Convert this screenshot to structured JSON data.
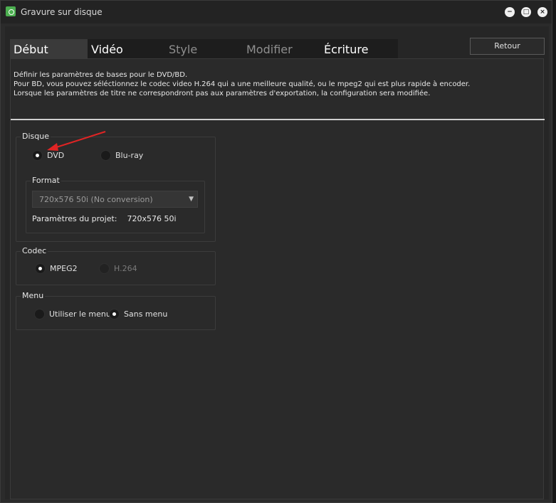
{
  "window": {
    "title": "Gravure sur disque"
  },
  "window_controls": [
    "minimize",
    "maximize",
    "close"
  ],
  "tabs": [
    {
      "label": "Début"
    },
    {
      "label": "Vidéo"
    },
    {
      "label": "Style"
    },
    {
      "label": "Modifier"
    },
    {
      "label": "Écriture"
    }
  ],
  "retour_label": "Retour",
  "description": {
    "line1": "Définir les paramètres de bases pour le DVD/BD.",
    "line2": "Pour BD, vous pouvez séléctionnez le codec video H.264 qui a une meilleure qualité, ou le mpeg2 qui est plus rapide à encoder.",
    "line3": "Lorsque les paramètres de titre ne correspondront pas aux paramètres d'exportation, la configuration sera modifiée."
  },
  "disque": {
    "label": "Disque",
    "options": [
      {
        "label": "DVD",
        "checked": true
      },
      {
        "label": "Blu-ray",
        "checked": false
      }
    ],
    "format": {
      "label": "Format",
      "selected": "720x576 50i (No conversion)",
      "project_label": "Paramètres du projet:",
      "project_value": "720x576 50i"
    }
  },
  "codec": {
    "label": "Codec",
    "options": [
      {
        "label": "MPEG2",
        "checked": true
      },
      {
        "label": "H.264",
        "checked": false,
        "disabled": true
      }
    ]
  },
  "menu": {
    "label": "Menu",
    "options": [
      {
        "label": "Utiliser le menu",
        "checked": false
      },
      {
        "label": "Sans menu",
        "checked": true
      }
    ]
  },
  "colors": {
    "annotation_arrow": "#e02424",
    "app_icon": "#4caf50"
  },
  "icons": {
    "app": "app-icon",
    "minimize": "minimize-icon",
    "maximize": "maximize-icon",
    "close": "close-icon",
    "dropdown": "chevron-down-icon"
  }
}
